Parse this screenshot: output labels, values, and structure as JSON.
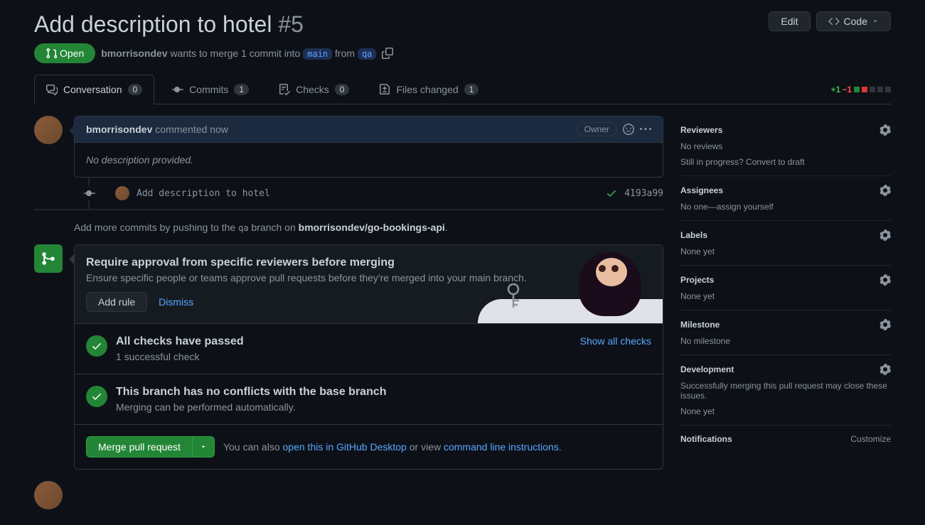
{
  "header": {
    "title": "Add description to hotel",
    "pr_number": "#5",
    "edit_label": "Edit",
    "code_label": "Code"
  },
  "meta": {
    "state": "Open",
    "author": "bmorrisondev",
    "merge_text_1": "wants to merge 1 commit into",
    "base_branch": "main",
    "merge_text_2": "from",
    "head_branch": "qa"
  },
  "tabs": {
    "conversation": {
      "label": "Conversation",
      "count": "0"
    },
    "commits": {
      "label": "Commits",
      "count": "1"
    },
    "checks": {
      "label": "Checks",
      "count": "0"
    },
    "files": {
      "label": "Files changed",
      "count": "1"
    }
  },
  "diffstat": {
    "additions": "+1",
    "deletions": "−1"
  },
  "comment": {
    "author": "bmorrisondev",
    "time_text": "commented now",
    "owner_label": "Owner",
    "body": "No description provided."
  },
  "commit": {
    "message": "Add description to hotel",
    "sha": "4193a99"
  },
  "push_hint": {
    "prefix": "Add more commits by pushing to the",
    "branch": "qa",
    "middle": "branch on",
    "repo": "bmorrisondev/go-bookings-api",
    "suffix": "."
  },
  "rule_panel": {
    "title": "Require approval from specific reviewers before merging",
    "desc": "Ensure specific people or teams approve pull requests before they're merged into your main branch.",
    "add_rule": "Add rule",
    "dismiss": "Dismiss"
  },
  "checks_panel": {
    "title": "All checks have passed",
    "desc": "1 successful check",
    "show_all": "Show all checks"
  },
  "conflict_panel": {
    "title": "This branch has no conflicts with the base branch",
    "desc": "Merging can be performed automatically."
  },
  "merge_panel": {
    "button": "Merge pull request",
    "hint_prefix": "You can also",
    "desktop_link": "open this in GitHub Desktop",
    "hint_middle": "or view",
    "cli_link": "command line instructions",
    "hint_suffix": "."
  },
  "sidebar": {
    "reviewers": {
      "title": "Reviewers",
      "body1": "No reviews",
      "body2": "Still in progress? Convert to draft"
    },
    "assignees": {
      "title": "Assignees",
      "body": "No one—assign yourself"
    },
    "labels": {
      "title": "Labels",
      "body": "None yet"
    },
    "projects": {
      "title": "Projects",
      "body": "None yet"
    },
    "milestone": {
      "title": "Milestone",
      "body": "No milestone"
    },
    "development": {
      "title": "Development",
      "body1": "Successfully merging this pull request may close these issues.",
      "body2": "None yet"
    },
    "notifications": {
      "title": "Notifications",
      "customize": "Customize"
    }
  }
}
